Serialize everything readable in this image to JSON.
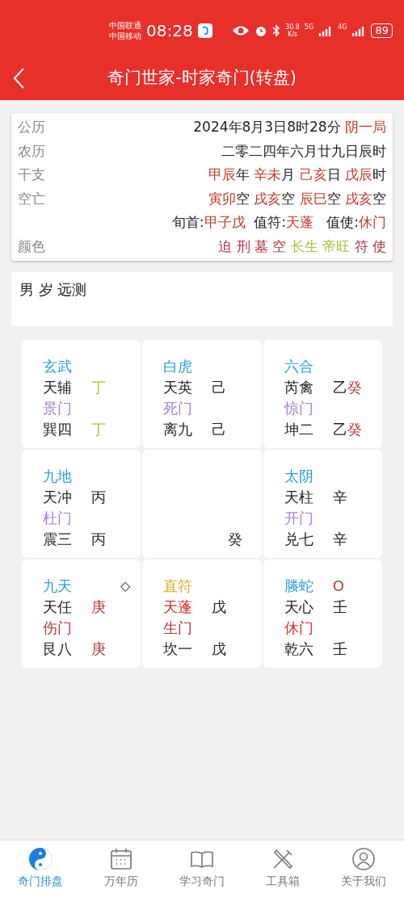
{
  "status_bar": {
    "carriers": [
      "中国联通",
      "中国移动"
    ],
    "time": "08:28",
    "speed": "30.8",
    "speed_unit": "K/s",
    "net_1": "5G",
    "net_2": "4G",
    "battery": "89"
  },
  "header": {
    "title": "奇门世家-时家奇门(转盘)"
  },
  "info": [
    {
      "label": "公历",
      "segments": [
        {
          "text": "2024年8月3日8时28分 ",
          "color": "#222222"
        },
        {
          "text": "阴一局",
          "color": "#c0392b"
        }
      ]
    },
    {
      "label": "农历",
      "segments": [
        {
          "text": "二零二四年六月廿九日辰时",
          "color": "#222222"
        }
      ]
    },
    {
      "label": "干支",
      "segments": [
        {
          "text": "甲辰",
          "color": "#c0392b"
        },
        {
          "text": "年 ",
          "color": "#222222"
        },
        {
          "text": "辛未",
          "color": "#c0392b"
        },
        {
          "text": "月 ",
          "color": "#222222"
        },
        {
          "text": "己亥",
          "color": "#c0392b"
        },
        {
          "text": "日 ",
          "color": "#222222"
        },
        {
          "text": "戊辰",
          "color": "#c0392b"
        },
        {
          "text": "时",
          "color": "#222222"
        }
      ]
    },
    {
      "label": "空亡",
      "segments": [
        {
          "text": "寅卯",
          "color": "#c0392b"
        },
        {
          "text": "空 ",
          "color": "#222222"
        },
        {
          "text": "戌亥",
          "color": "#c0392b"
        },
        {
          "text": "空 ",
          "color": "#222222"
        },
        {
          "text": "辰巳",
          "color": "#c0392b"
        },
        {
          "text": "空 ",
          "color": "#222222"
        },
        {
          "text": "戌亥",
          "color": "#c0392b"
        },
        {
          "text": "空",
          "color": "#222222"
        }
      ]
    },
    {
      "segments": [
        {
          "text": "旬首:",
          "color": "#222222"
        },
        {
          "text": "甲子戊",
          "color": "#c0392b"
        },
        {
          "text": "  值符:",
          "color": "#222222"
        },
        {
          "text": "天蓬",
          "color": "#c0392b"
        },
        {
          "text": "   值使:",
          "color": "#222222"
        },
        {
          "text": "休门",
          "color": "#c0392b"
        }
      ]
    },
    {
      "label": "颜色",
      "segments": [
        {
          "text": "迫 ",
          "color": "#b03040"
        },
        {
          "text": "刑 ",
          "color": "#b03040"
        },
        {
          "text": "墓 ",
          "color": "#b03040"
        },
        {
          "text": "空 ",
          "color": "#b03040"
        },
        {
          "text": "长生 ",
          "color": "#a8c040"
        },
        {
          "text": "帝旺 ",
          "color": "#a8c040"
        },
        {
          "text": "符 ",
          "color": "#b03040"
        },
        {
          "text": "使",
          "color": "#b03040"
        }
      ]
    }
  ],
  "remark": "男 岁 远测",
  "palaces": [
    {
      "kind": "normal",
      "rows": [
        {
          "left": {
            "text": "玄武",
            "color": "#2a9fd0"
          }
        },
        {
          "left": {
            "text": "天辅",
            "color": "#222222"
          },
          "right": [
            {
              "text": "丁",
              "color": "#a8c040"
            }
          ]
        },
        {
          "left": {
            "text": "景门",
            "color": "#a77fd0"
          }
        },
        {
          "left": {
            "text": "巽四",
            "color": "#222222"
          },
          "right": [
            {
              "text": "丁",
              "color": "#a8c040"
            }
          ]
        }
      ]
    },
    {
      "kind": "normal",
      "rows": [
        {
          "left": {
            "text": "白虎",
            "color": "#2a9fd0"
          }
        },
        {
          "left": {
            "text": "天英",
            "color": "#222222"
          },
          "right": [
            {
              "text": "己",
              "color": "#222222"
            }
          ]
        },
        {
          "left": {
            "text": "死门",
            "color": "#a77fd0"
          }
        },
        {
          "left": {
            "text": "离九",
            "color": "#222222"
          },
          "right": [
            {
              "text": "己",
              "color": "#222222"
            }
          ]
        }
      ]
    },
    {
      "kind": "normal",
      "rows": [
        {
          "left": {
            "text": "六合",
            "color": "#2a9fd0"
          }
        },
        {
          "left": {
            "text": "芮禽",
            "color": "#222222"
          },
          "right": [
            {
              "text": "乙",
              "color": "#222222"
            },
            {
              "text": "癸",
              "color": "#b03a3a"
            }
          ]
        },
        {
          "left": {
            "text": "惊门",
            "color": "#a77fd0"
          }
        },
        {
          "left": {
            "text": "坤二",
            "color": "#222222"
          },
          "right": [
            {
              "text": "乙",
              "color": "#222222"
            },
            {
              "text": "癸",
              "color": "#b03a3a"
            }
          ]
        }
      ]
    },
    {
      "kind": "normal",
      "rows": [
        {
          "left": {
            "text": "九地",
            "color": "#2a9fd0"
          }
        },
        {
          "left": {
            "text": "天冲",
            "color": "#222222"
          },
          "right": [
            {
              "text": "丙",
              "color": "#222222"
            }
          ]
        },
        {
          "left": {
            "text": "杜门",
            "color": "#a77fd0"
          }
        },
        {
          "left": {
            "text": "震三",
            "color": "#222222"
          },
          "right": [
            {
              "text": "丙",
              "color": "#222222"
            }
          ]
        }
      ]
    },
    {
      "kind": "center",
      "corner": "癸"
    },
    {
      "kind": "normal",
      "rows": [
        {
          "left": {
            "text": "太阴",
            "color": "#2a9fd0"
          }
        },
        {
          "left": {
            "text": "天柱",
            "color": "#222222"
          },
          "right": [
            {
              "text": "辛",
              "color": "#222222"
            }
          ]
        },
        {
          "left": {
            "text": "开门",
            "color": "#a77fd0"
          }
        },
        {
          "left": {
            "text": "兑七",
            "color": "#222222"
          },
          "right": [
            {
              "text": "辛",
              "color": "#222222"
            }
          ]
        }
      ]
    },
    {
      "kind": "normal",
      "rows": [
        {
          "left": {
            "text": "九天",
            "color": "#2a9fd0"
          },
          "mark": "◇"
        },
        {
          "left": {
            "text": "天任",
            "color": "#222222"
          },
          "right": [
            {
              "text": "庚",
              "color": "#b03a3a"
            }
          ]
        },
        {
          "left": {
            "text": "伤门",
            "color": "#b03a3a"
          }
        },
        {
          "left": {
            "text": "艮八",
            "color": "#222222"
          },
          "right": [
            {
              "text": "庚",
              "color": "#b03a3a"
            }
          ]
        }
      ]
    },
    {
      "kind": "normal",
      "rows": [
        {
          "left": {
            "text": "直符",
            "color": "#d4b020"
          }
        },
        {
          "left": {
            "text": "天蓬",
            "color": "#d03030"
          },
          "right": [
            {
              "text": "戊",
              "color": "#222222"
            }
          ]
        },
        {
          "left": {
            "text": "生门",
            "color": "#c0303a"
          }
        },
        {
          "left": {
            "text": "坎一",
            "color": "#222222"
          },
          "right": [
            {
              "text": "戊",
              "color": "#222222"
            }
          ]
        }
      ]
    },
    {
      "kind": "normal",
      "rows": [
        {
          "left": {
            "text": "螣蛇",
            "color": "#2a9fd0"
          },
          "right": [
            {
              "text": "O",
              "color": "#b03a3a"
            }
          ]
        },
        {
          "left": {
            "text": "天心",
            "color": "#222222"
          },
          "right": [
            {
              "text": "壬",
              "color": "#222222"
            }
          ]
        },
        {
          "left": {
            "text": "休门",
            "color": "#d03030"
          }
        },
        {
          "left": {
            "text": "乾六",
            "color": "#222222"
          },
          "right": [
            {
              "text": "壬",
              "color": "#222222"
            }
          ]
        }
      ]
    }
  ],
  "nav": [
    {
      "label": "奇门排盘",
      "selected": true
    },
    {
      "label": "万年历",
      "selected": false
    },
    {
      "label": "学习奇门",
      "selected": false
    },
    {
      "label": "工具箱",
      "selected": false
    },
    {
      "label": "关于我们",
      "selected": false
    }
  ]
}
